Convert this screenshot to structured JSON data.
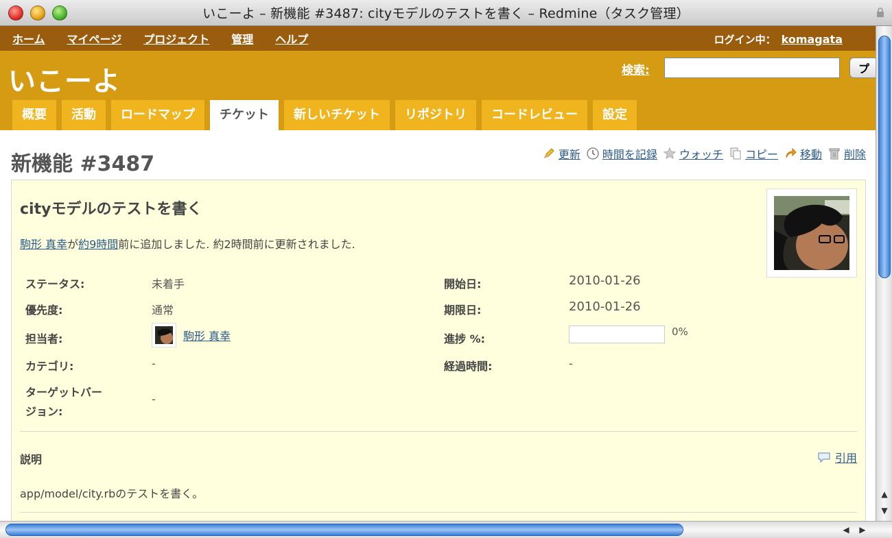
{
  "window": {
    "title": "いこーよ – 新機能 #3487: cityモデルのテストを書く – Redmine（タスク管理）"
  },
  "topmenu": {
    "items": [
      "ホーム",
      "マイページ",
      "プロジェクト",
      "管理",
      "ヘルプ"
    ],
    "logged_in_label": "ログイン中：",
    "user": "komagata"
  },
  "header": {
    "project_title": "いこーよ",
    "search_label": "検索:",
    "search_value": "",
    "search_button": "プ"
  },
  "tabs": [
    {
      "label": "概要",
      "selected": false
    },
    {
      "label": "活動",
      "selected": false
    },
    {
      "label": "ロードマップ",
      "selected": false
    },
    {
      "label": "チケット",
      "selected": true
    },
    {
      "label": "新しいチケット",
      "selected": false
    },
    {
      "label": "リポジトリ",
      "selected": false
    },
    {
      "label": "コードレビュー",
      "selected": false
    },
    {
      "label": "設定",
      "selected": false
    }
  ],
  "page": {
    "title": "新機能 #3487",
    "actions": [
      {
        "label": "更新",
        "icon": "pencil-icon"
      },
      {
        "label": "時間を記録",
        "icon": "clock-icon"
      },
      {
        "label": "ウォッチ",
        "icon": "star-icon"
      },
      {
        "label": "コピー",
        "icon": "copy-icon"
      },
      {
        "label": "移動",
        "icon": "move-arrow-icon"
      },
      {
        "label": "削除",
        "icon": "trash-icon"
      }
    ]
  },
  "issue": {
    "subject": "cityモデルのテストを書く",
    "author": "駒形 真幸",
    "author_suffix": "が",
    "added_time": "約9時間",
    "added_suffix": "前に追加しました. 約2時間前に更新されました.",
    "attributes": {
      "status_label": "ステータス:",
      "status": "未着手",
      "priority_label": "優先度:",
      "priority": "通常",
      "assignee_label": "担当者:",
      "assignee": "駒形 真幸",
      "category_label": "カテゴリ:",
      "category": "-",
      "target_version_label_1": "ターゲットバー",
      "target_version_label_2": "ジョン:",
      "target_version": "-",
      "start_date_label": "開始日:",
      "start_date": "2010-01-26",
      "due_date_label": "期限日:",
      "due_date": "2010-01-26",
      "progress_label": "進捗 %:",
      "progress": "0%",
      "spent_time_label": "経過時間:",
      "spent_time": "-"
    },
    "description_title": "説明",
    "quote_label": "引用",
    "description": "app/model/city.rbのテストを書く。"
  }
}
